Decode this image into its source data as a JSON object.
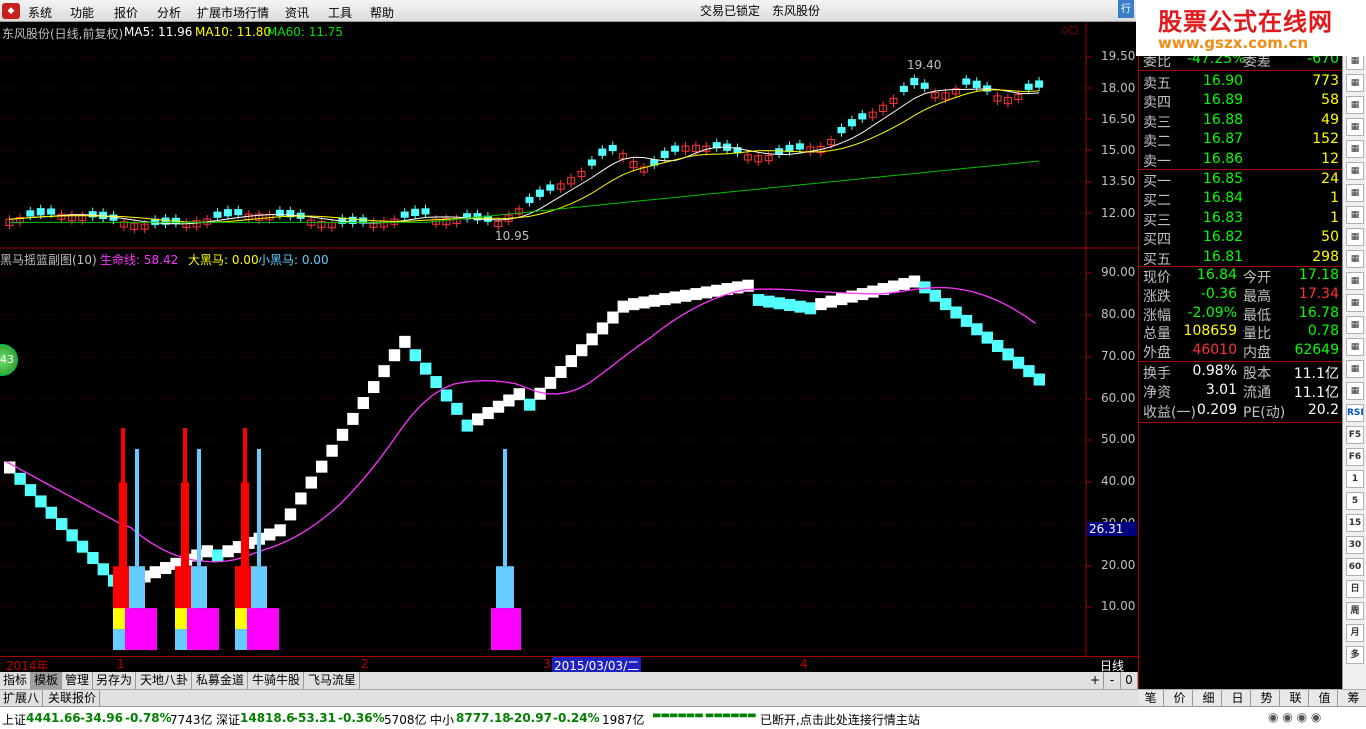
{
  "menu": {
    "items": [
      "系统",
      "功能",
      "报价",
      "分析",
      "扩展市场行情",
      "资讯",
      "工具",
      "帮助"
    ],
    "center_title": [
      "交易已锁定",
      "东风股份"
    ]
  },
  "watermark": {
    "title": "股票公式在线网",
    "url": "www.gszx.com.cn",
    "tab": "行"
  },
  "main_chart": {
    "header": {
      "name": "东风股份(日线,前复权)",
      "ma5": "MA5: 11.96",
      "ma10": "MA10: 11.80",
      "ma60": "MA60: 11.75"
    },
    "y_ticks": [
      "19.50",
      "18.00",
      "16.50",
      "15.00",
      "13.50",
      "12.00"
    ],
    "high_label": "19.40",
    "low_label": "10.95"
  },
  "sub_chart": {
    "header": {
      "name": "黑马摇篮副图(10)",
      "line": "生命线: 58.42",
      "big": "大黑马: 0.00",
      "small": "小黑马: 0.00"
    },
    "y_ticks": [
      "90.00",
      "80.00",
      "70.00",
      "60.00",
      "50.00",
      "40.00",
      "30.00",
      "20.00",
      "10.00"
    ],
    "cursor_value": "26.31",
    "badge": "43"
  },
  "date_axis": {
    "labels": [
      "2014年",
      "1",
      "2",
      "3",
      "4"
    ],
    "cursor_date": "2015/03/03/二",
    "period": "日线"
  },
  "quote": {
    "weibi": {
      "label": "委比",
      "value": "-47.25%",
      "label2": "委差",
      "value2": "-670"
    },
    "asks": [
      {
        "label": "卖五",
        "price": "16.90",
        "vol": "773"
      },
      {
        "label": "卖四",
        "price": "16.89",
        "vol": "58"
      },
      {
        "label": "卖三",
        "price": "16.88",
        "vol": "49"
      },
      {
        "label": "卖二",
        "price": "16.87",
        "vol": "152"
      },
      {
        "label": "卖一",
        "price": "16.86",
        "vol": "12"
      }
    ],
    "bids": [
      {
        "label": "买一",
        "price": "16.85",
        "vol": "24"
      },
      {
        "label": "买二",
        "price": "16.84",
        "vol": "1"
      },
      {
        "label": "买三",
        "price": "16.83",
        "vol": "1"
      },
      {
        "label": "买四",
        "price": "16.82",
        "vol": "50"
      },
      {
        "label": "买五",
        "price": "16.81",
        "vol": "298"
      }
    ],
    "stats": [
      {
        "l1": "现价",
        "v1": "16.84",
        "c1": "#00ff00",
        "l2": "今开",
        "v2": "17.18",
        "c2": "#00ff00"
      },
      {
        "l1": "涨跌",
        "v1": "-0.36",
        "c1": "#00ff00",
        "l2": "最高",
        "v2": "17.34",
        "c2": "#ff3232"
      },
      {
        "l1": "涨幅",
        "v1": "-2.09%",
        "c1": "#00ff00",
        "l2": "最低",
        "v2": "16.78",
        "c2": "#00ff00"
      },
      {
        "l1": "总量",
        "v1": "108659",
        "c1": "#ffff00",
        "l2": "量比",
        "v2": "0.78",
        "c2": "#00ff00"
      },
      {
        "l1": "外盘",
        "v1": "46010",
        "c1": "#ff3232",
        "l2": "内盘",
        "v2": "62649",
        "c2": "#00ff00"
      }
    ],
    "extra": [
      {
        "l1": "换手",
        "v1": "0.98%",
        "l2": "股本",
        "v2": "11.1亿"
      },
      {
        "l1": "净资",
        "v1": "3.01",
        "l2": "流通",
        "v2": "11.1亿"
      },
      {
        "l1": "收益(一)",
        "v1": "0.209",
        "l2": "PE(动)",
        "v2": "20.2"
      }
    ]
  },
  "tools": [
    "RSI",
    "F5",
    "F6",
    "1",
    "5",
    "15",
    "30",
    "60",
    "日",
    "周",
    "月",
    "多"
  ],
  "tabs1": [
    "指标",
    "模板",
    "管理",
    "另存为",
    "天地八卦",
    "私募金道",
    "牛骑牛股",
    "飞马流星"
  ],
  "tabs1_buttons": [
    "+",
    "-",
    "0"
  ],
  "tabs2": [
    "扩展八",
    "关联报价"
  ],
  "right_tabs": [
    "笔",
    "价",
    "细",
    "日",
    "势",
    "联",
    "值",
    "筹"
  ],
  "status": {
    "sh": {
      "label": "上证",
      "value": "4441.66",
      "chg": "-34.96",
      "pct": "-0.78%",
      "amt": "7743亿"
    },
    "sz": {
      "label": "深证",
      "value": "14818.6",
      "chg": "-53.31",
      "pct": "-0.36%",
      "amt": "5708亿"
    },
    "zx": {
      "label": "中小",
      "value": "8777.18",
      "chg": "-20.97",
      "pct": "-0.24%",
      "amt": "1987亿"
    },
    "msg": "已断开,点击此处连接行情主站"
  }
}
